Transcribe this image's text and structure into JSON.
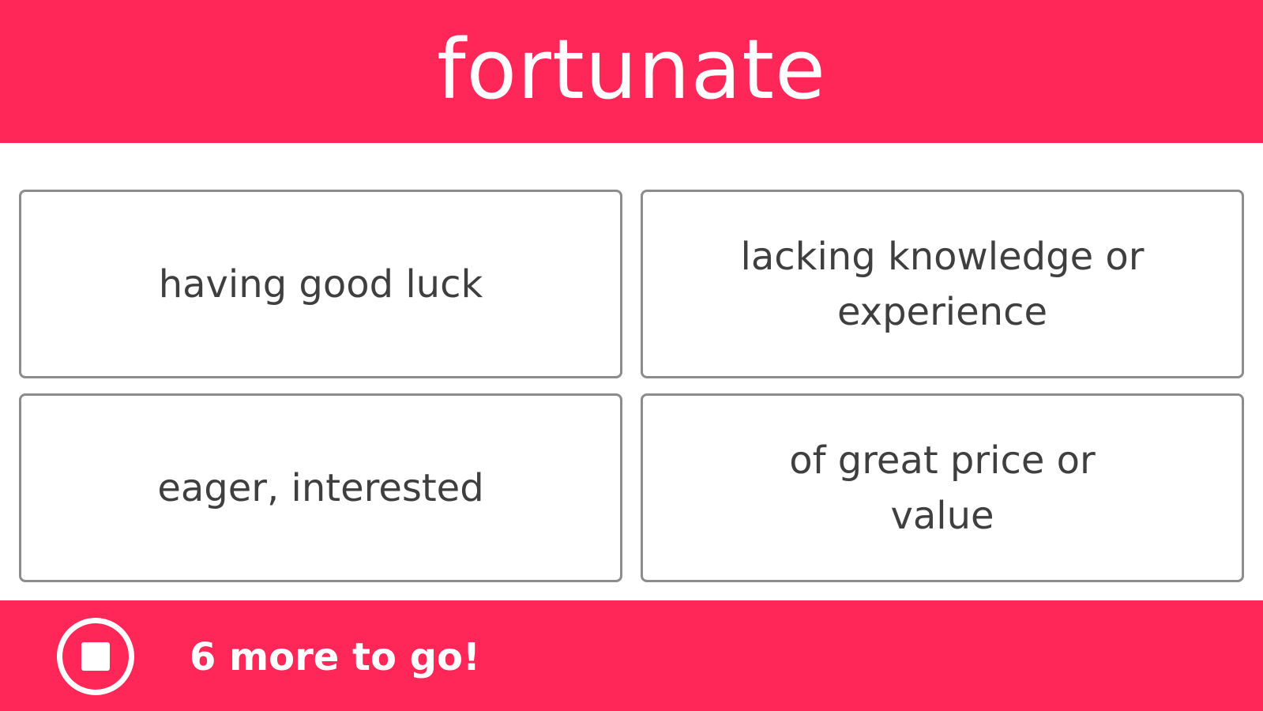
{
  "header": {
    "word": "fortunate"
  },
  "choices": [
    {
      "label": "having good luck"
    },
    {
      "label": "lacking knowledge or experience"
    },
    {
      "label": "eager, interested"
    },
    {
      "label": "of great price or value"
    }
  ],
  "footer": {
    "stop_icon": "stop-icon",
    "progress_text": "6 more to go!"
  },
  "colors": {
    "accent": "#ff2757",
    "text": "#3f3f3f",
    "border": "#8c8c8c",
    "background": "#ffffff"
  }
}
